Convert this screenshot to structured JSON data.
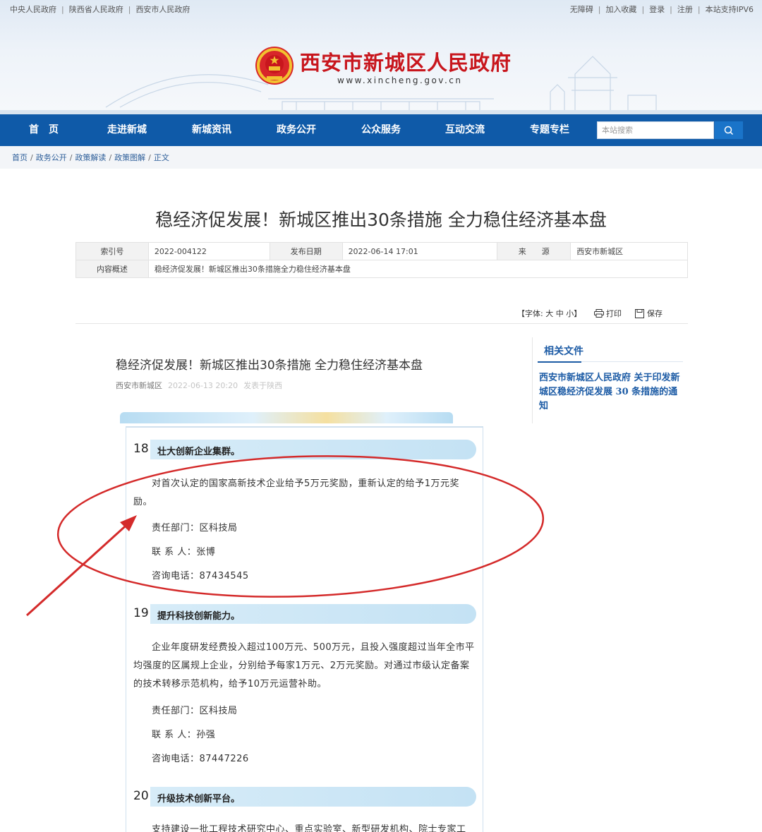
{
  "top_links": {
    "left": [
      "中央人民政府",
      "陕西省人民政府",
      "西安市人民政府"
    ],
    "right": [
      "无障碍",
      "加入收藏",
      "登录",
      "注册",
      "本站支持IPV6"
    ]
  },
  "site": {
    "title": "西安市新城区人民政府",
    "url": "www.xincheng.gov.cn"
  },
  "nav": {
    "items": [
      "首　页",
      "走进新城",
      "新城资讯",
      "政务公开",
      "公众服务",
      "互动交流",
      "专题专栏"
    ],
    "search_placeholder": "本站搜索"
  },
  "breadcrumb": [
    "首页",
    "政务公开",
    "政策解读",
    "政策图解",
    "正文"
  ],
  "article": {
    "title": "稳经济促发展！新城区推出30条措施 全力稳住经济基本盘",
    "meta": {
      "index_label": "索引号",
      "index_value": "2022-004122",
      "date_label": "发布日期",
      "date_value": "2022-06-14 17:01",
      "source_label": "来　　源",
      "source_value": "西安市新城区",
      "summary_label": "内容概述",
      "summary_value": "稳经济促发展！新城区推出30条措施全力稳住经济基本盘"
    },
    "tools": {
      "font_size": "【字体: 大 中 小】",
      "print": "打印",
      "save": "保存"
    }
  },
  "body": {
    "sub_title": "稳经济促发展！新城区推出30条措施 全力稳住经济基本盘",
    "author": "西安市新城区",
    "date": "2022-06-13 20:20",
    "location": "发表于陕西"
  },
  "related": {
    "heading": "相关文件",
    "link": "西安市新城区人民政府 关于印发新城区稳经济促发展 30 条措施的通知"
  },
  "sections": [
    {
      "num": "18",
      "title": "壮大创新企业集群。",
      "text": "对首次认定的国家高新技术企业给予5万元奖励，重新认定的给予1万元奖励。",
      "dept": "责任部门：区科技局",
      "contact": "联 系 人：张博",
      "phone": "咨询电话：87434545"
    },
    {
      "num": "19",
      "title": "提升科技创新能力。",
      "text": "企业年度研发经费投入超过100万元、500万元，且投入强度超过当年全市平均强度的区属规上企业，分别给予每家1万元、2万元奖励。对通过市级认定备案的技术转移示范机构，给予10万元运营补助。",
      "dept": "责任部门：区科技局",
      "contact": "联 系 人：孙强",
      "phone": "咨询电话：87447226"
    },
    {
      "num": "20",
      "title": "升级技术创新平台。",
      "text": "支持建设一批工程技术研究中心、重点实验室、新型研发机构、院士专家工"
    }
  ],
  "colors": {
    "brand_red": "#c8161d",
    "nav_blue": "#0f5aa8",
    "link_blue": "#1c5ba5",
    "annotation_red": "#d42a2a"
  }
}
